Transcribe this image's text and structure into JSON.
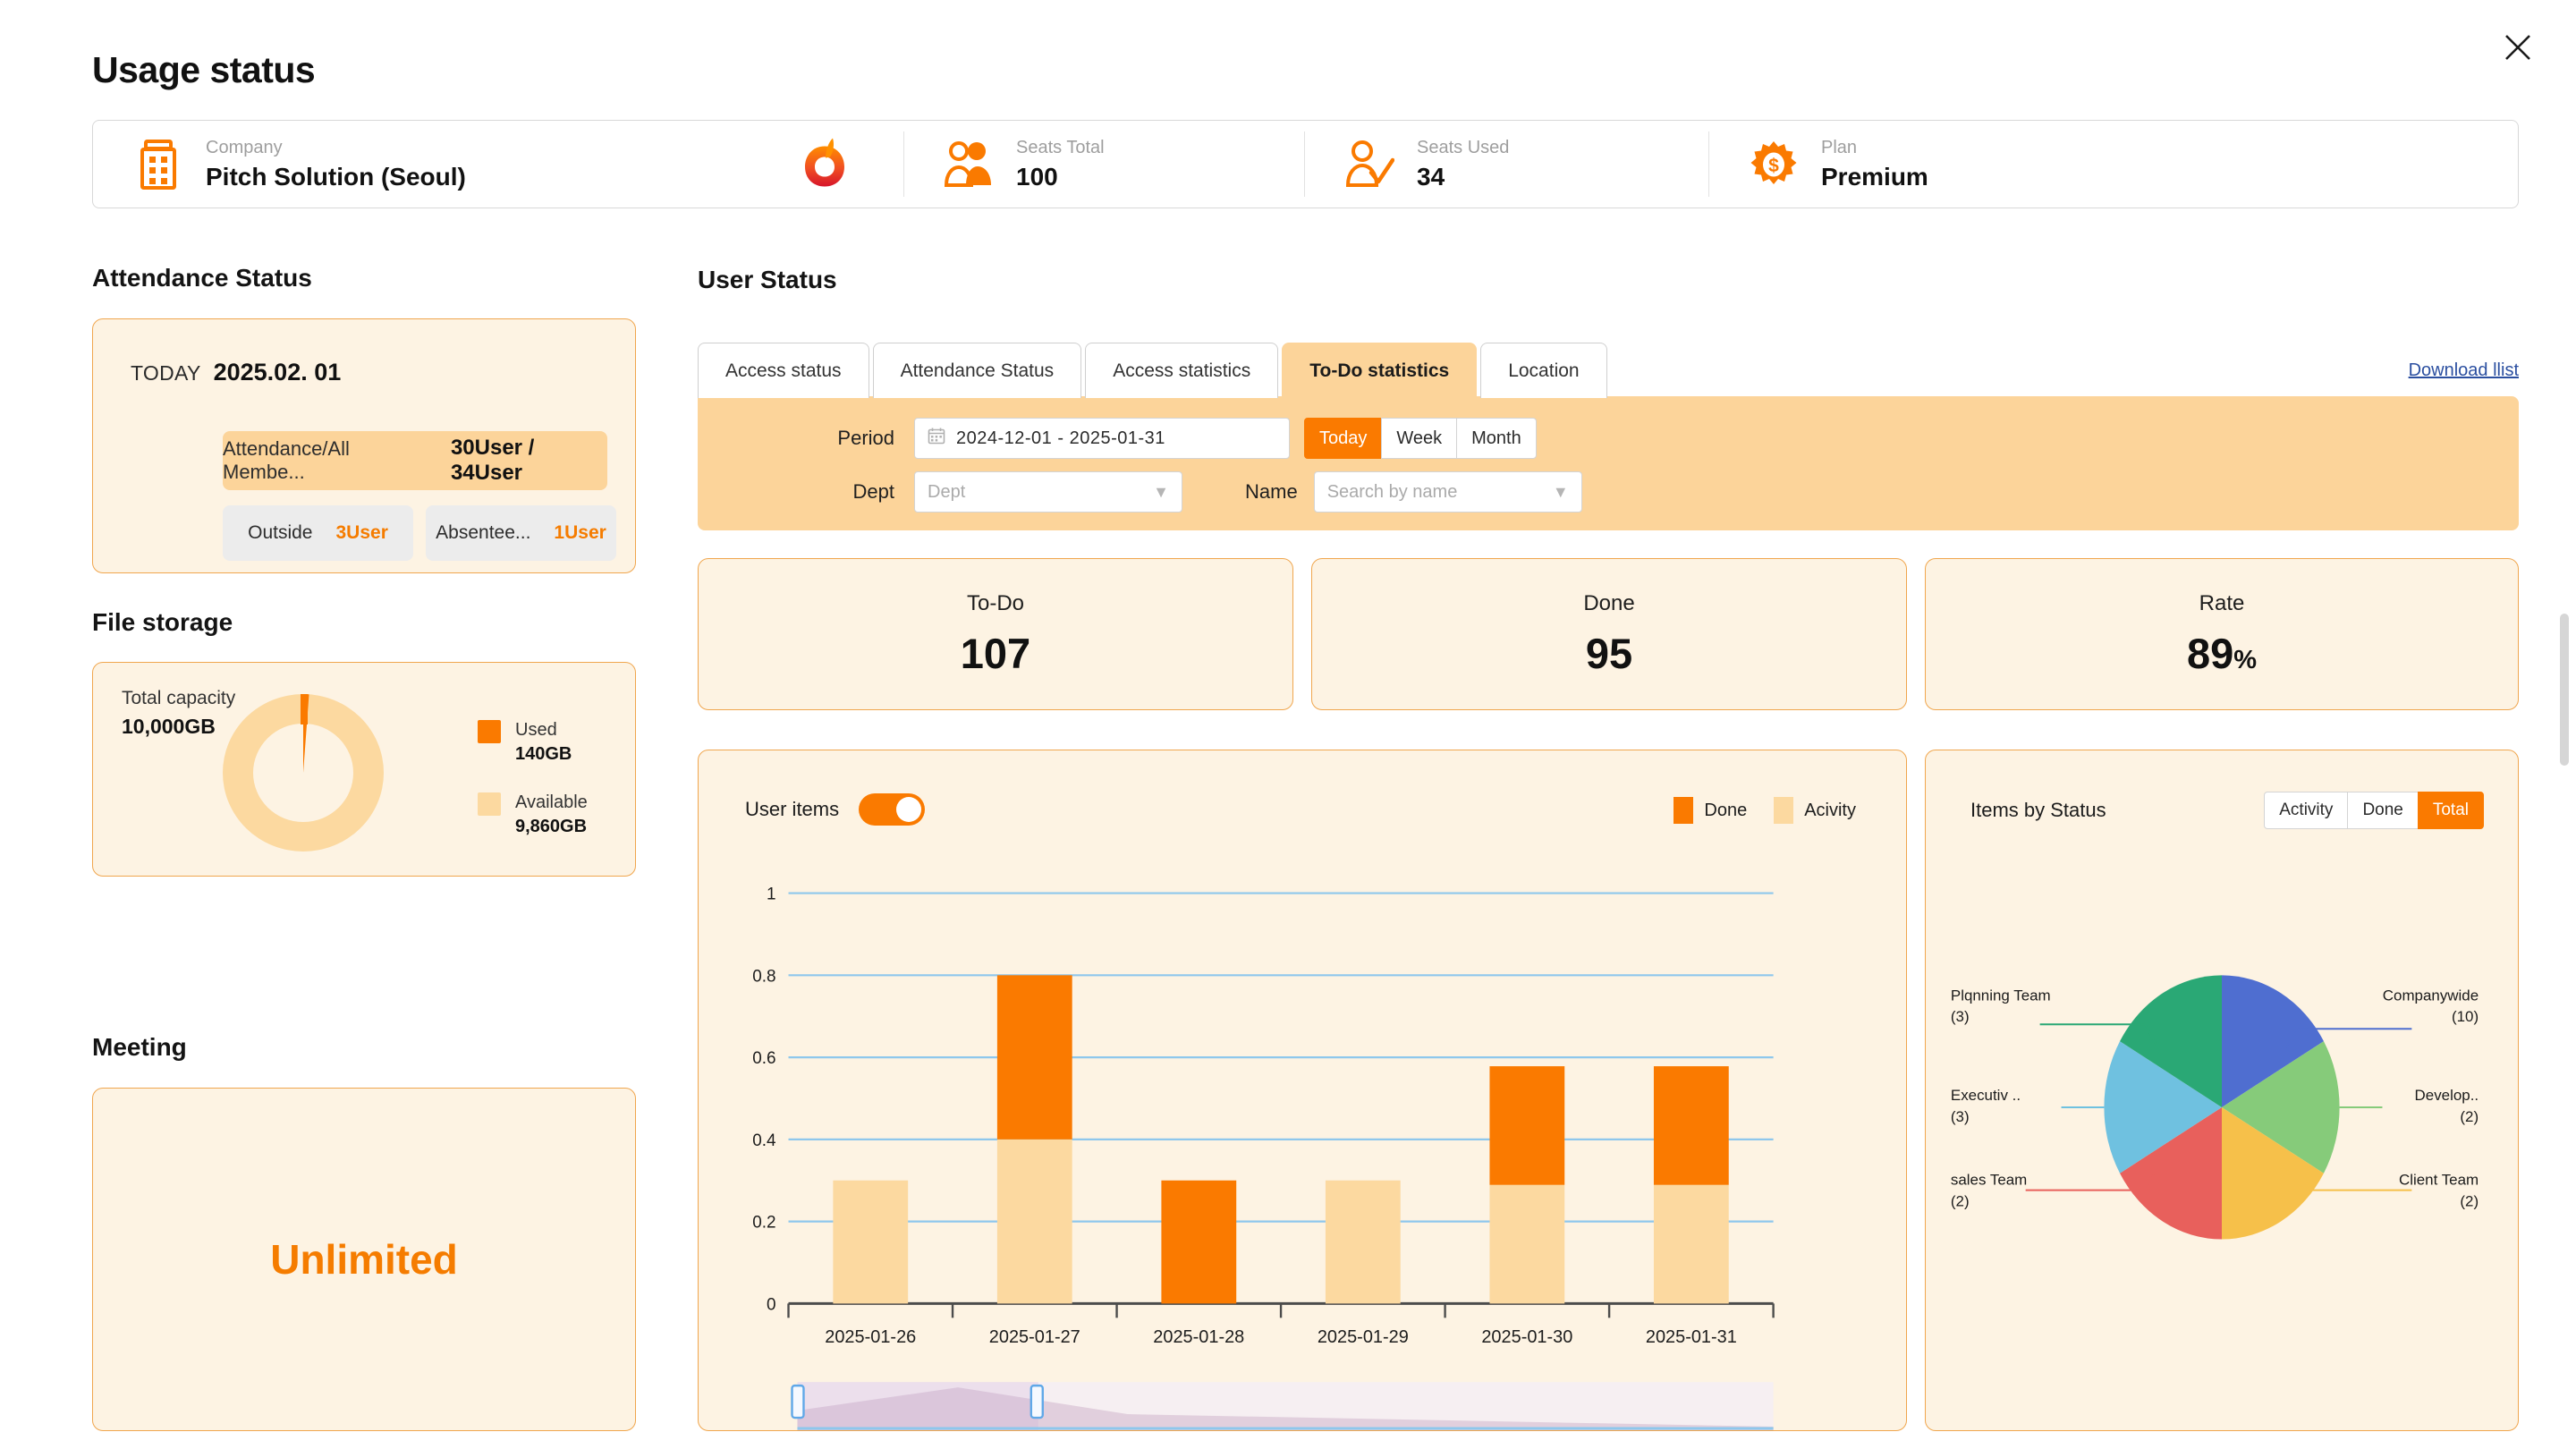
{
  "window": {
    "title": "Usage status",
    "close_icon": "close-icon"
  },
  "info_bar": {
    "cells": [
      {
        "icon": "building-icon",
        "label": "Company",
        "value": "Pitch Solution (Seoul)"
      },
      {
        "icon": "users-icon",
        "label": "Seats Total",
        "value": "100"
      },
      {
        "icon": "user-check-icon",
        "label": "Seats Used",
        "value": "34"
      },
      {
        "icon": "gear-dollar-icon",
        "label": "Plan",
        "value": "Premium"
      }
    ],
    "brand_logo": "apple-brand-logo"
  },
  "attendance": {
    "heading": "Attendance Status",
    "today_label": "TODAY",
    "today_date": "2025.02. 01",
    "main_label": "Attendance/All Membe...",
    "main_value": "30User / 34User",
    "outside_label": "Outside",
    "outside_value": "3User",
    "absent_label": "Absentee...",
    "absent_value": "1User"
  },
  "storage": {
    "heading": "File storage",
    "capacity_label": "Total capacity",
    "capacity_value": "10,000GB",
    "legend": [
      {
        "name": "Used",
        "value": "140GB",
        "color": "#fa7a00"
      },
      {
        "name": "Available",
        "value": "9,860GB",
        "color": "#fcd9a0"
      }
    ]
  },
  "meeting": {
    "heading": "Meeting",
    "value": "Unlimited"
  },
  "user_status": {
    "heading": "User Status",
    "tabs": [
      {
        "label": "Access status",
        "active": false
      },
      {
        "label": "Attendance Status",
        "active": false
      },
      {
        "label": "Access statistics",
        "active": false
      },
      {
        "label": "To-Do statistics",
        "active": true
      },
      {
        "label": "Location",
        "active": false
      }
    ],
    "download_link": "Download llist"
  },
  "filters": {
    "period_label": "Period",
    "date_icon": "calendar-icon",
    "date_value": "2024-12-01  -  2025-01-31",
    "range_buttons": [
      {
        "label": "Today",
        "active": true
      },
      {
        "label": "Week",
        "active": false
      },
      {
        "label": "Month",
        "active": false
      }
    ],
    "dept_label": "Dept",
    "dept_placeholder": "Dept",
    "name_label": "Name",
    "name_placeholder": "Search by name",
    "chevron_icon": "chevron-down-icon"
  },
  "stats": [
    {
      "label": "To-Do",
      "value": "107",
      "suffix": ""
    },
    {
      "label": "Done",
      "value": "95",
      "suffix": ""
    },
    {
      "label": "Rate",
      "value": "89",
      "suffix": "%"
    }
  ],
  "bar_panel": {
    "toggle_label": "User items",
    "toggle_on": true
  },
  "pie_panel": {
    "heading": "Items by Status",
    "buttons": [
      {
        "label": "Activity",
        "active": false
      },
      {
        "label": "Done",
        "active": false
      },
      {
        "label": "Total",
        "active": true
      }
    ]
  },
  "chart_data": [
    {
      "type": "bar",
      "title": "",
      "stacked": true,
      "categories": [
        "2025-01-26",
        "2025-01-27",
        "2025-01-28",
        "2025-01-29",
        "2025-01-30",
        "2025-01-31"
      ],
      "series": [
        {
          "name": "Acivity",
          "color": "#fcd9a0",
          "values": [
            0.3,
            0.4,
            0.0,
            0.3,
            0.29,
            0.29
          ]
        },
        {
          "name": "Done",
          "color": "#fa7a00",
          "values": [
            0.0,
            0.4,
            0.3,
            0.0,
            0.29,
            0.29
          ]
        }
      ],
      "xlabel": "",
      "ylabel": "",
      "ylim": [
        0,
        1
      ],
      "yticks": [
        "0",
        "0.2",
        "0.4",
        "0.6",
        "0.8",
        "1"
      ],
      "grid": true,
      "legend_position": "top-right",
      "brush": {
        "visible": true,
        "start_pct": 0,
        "end_pct": 33
      }
    },
    {
      "type": "pie",
      "title": "Items by Status",
      "labels": [
        "Companywide",
        "Develop..",
        "Client Team",
        "sales Team",
        "Executiv ..",
        "Plqnning Team"
      ],
      "values": [
        10,
        2,
        2,
        2,
        3,
        3
      ],
      "display_counts": [
        "(10)",
        "(2)",
        "(2)",
        "(2)",
        "(3)",
        "(3)"
      ],
      "colors": [
        "#4f6ed0",
        "#7fc островom"
      ],
      "slice_colors": [
        "#4f6ed0",
        "#86cb7a",
        "#f6c04a",
        "#e8605c",
        "#6fc1e0",
        "#2aa875"
      ],
      "equal_slices": true,
      "legend_position": "callout-labels"
    },
    {
      "type": "pie",
      "title": "File storage",
      "donut": true,
      "labels": [
        "Used",
        "Available"
      ],
      "values": [
        140,
        9860
      ],
      "units": "GB",
      "colors": [
        "#fa7a00",
        "#fcd9a0"
      ],
      "total": 10000
    }
  ]
}
